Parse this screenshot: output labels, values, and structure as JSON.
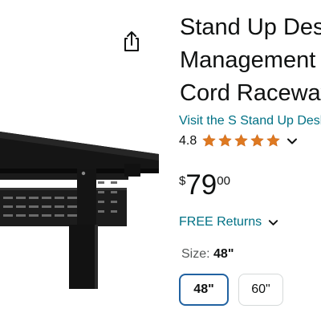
{
  "product": {
    "title_lines": [
      "Stand Up Desk",
      "Management",
      "Cord Raceway"
    ],
    "brand_link": "Visit the S Stand Up Desk",
    "rating": "4.8",
    "stars": 5,
    "price": {
      "symbol": "$",
      "whole": "79",
      "fraction": "00"
    },
    "free_returns": "FREE Returns"
  },
  "size": {
    "label": "Size:",
    "selected": "48\"",
    "options": [
      "48\"",
      "60\""
    ]
  },
  "colors": {
    "link": "#007185",
    "star": "#de7921",
    "selected_border": "#2162a1"
  },
  "icons": {
    "share": "share-icon",
    "rating_dropdown": "chevron-down-icon",
    "returns_dropdown": "chevron-down-icon"
  }
}
